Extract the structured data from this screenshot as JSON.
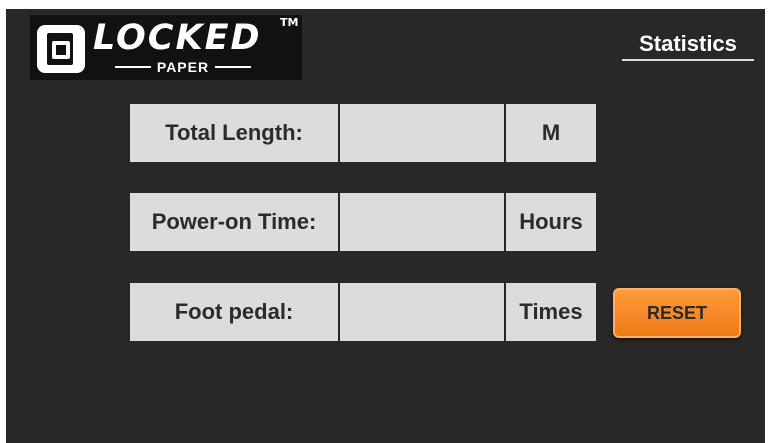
{
  "header": {
    "logo_word": "LOCKED",
    "logo_tm": "TM",
    "logo_sub": "PAPER",
    "tab_label": "Statistics"
  },
  "rows": [
    {
      "label": "Total Length:",
      "value": "",
      "unit": "M"
    },
    {
      "label": "Power-on Time:",
      "value": "",
      "unit": "Hours"
    },
    {
      "label": "Foot pedal:",
      "value": "",
      "unit": "Times"
    }
  ],
  "reset_label": "RESET",
  "colors": {
    "screen_bg": "#282828",
    "cell_bg": "#dcdcdc",
    "accent": "#f58a26"
  }
}
